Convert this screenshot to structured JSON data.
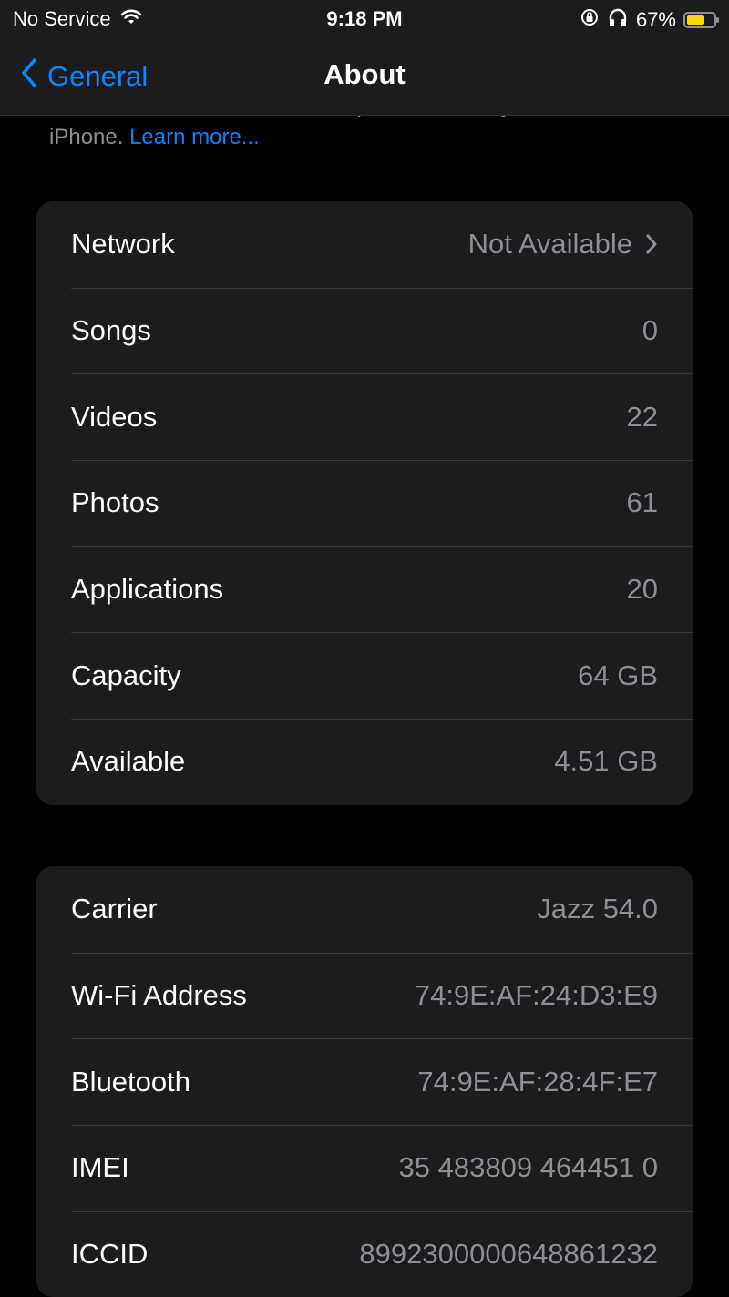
{
  "status_bar": {
    "carrier": "No Service",
    "time": "9:18 PM",
    "battery": "67%",
    "battery_level": 0.67,
    "battery_color": "#ffd60a",
    "icons": [
      "wifi-icon",
      "orientation-lock-icon",
      "headphones-icon",
      "battery-icon"
    ]
  },
  "nav": {
    "back_label": "General",
    "title": "About"
  },
  "intro": {
    "text": "information on the status and repair details for your iPhone.",
    "text_cut": "information on the status and repair details for your",
    "text_end": "iPhone.",
    "link": "Learn more..."
  },
  "group1": [
    {
      "label": "Network",
      "value": "Not Available",
      "chevron": true
    },
    {
      "label": "Songs",
      "value": "0"
    },
    {
      "label": "Videos",
      "value": "22"
    },
    {
      "label": "Photos",
      "value": "61"
    },
    {
      "label": "Applications",
      "value": "20"
    },
    {
      "label": "Capacity",
      "value": "64 GB"
    },
    {
      "label": "Available",
      "value": "4.51 GB"
    }
  ],
  "group2": [
    {
      "label": "Carrier",
      "value": "Jazz 54.0"
    },
    {
      "label": "Wi-Fi Address",
      "value": "74:9E:AF:24:D3:E9"
    },
    {
      "label": "Bluetooth",
      "value": "74:9E:AF:28:4F:E7"
    },
    {
      "label": "IMEI",
      "value": "35 483809 464451 0"
    },
    {
      "label": "ICCID",
      "value": "8992300000648861232"
    }
  ],
  "colors": {
    "accent": "#0a84ff",
    "background": "#000000",
    "cell": "#1c1c1e",
    "secondary_text": "#8e8e93"
  }
}
